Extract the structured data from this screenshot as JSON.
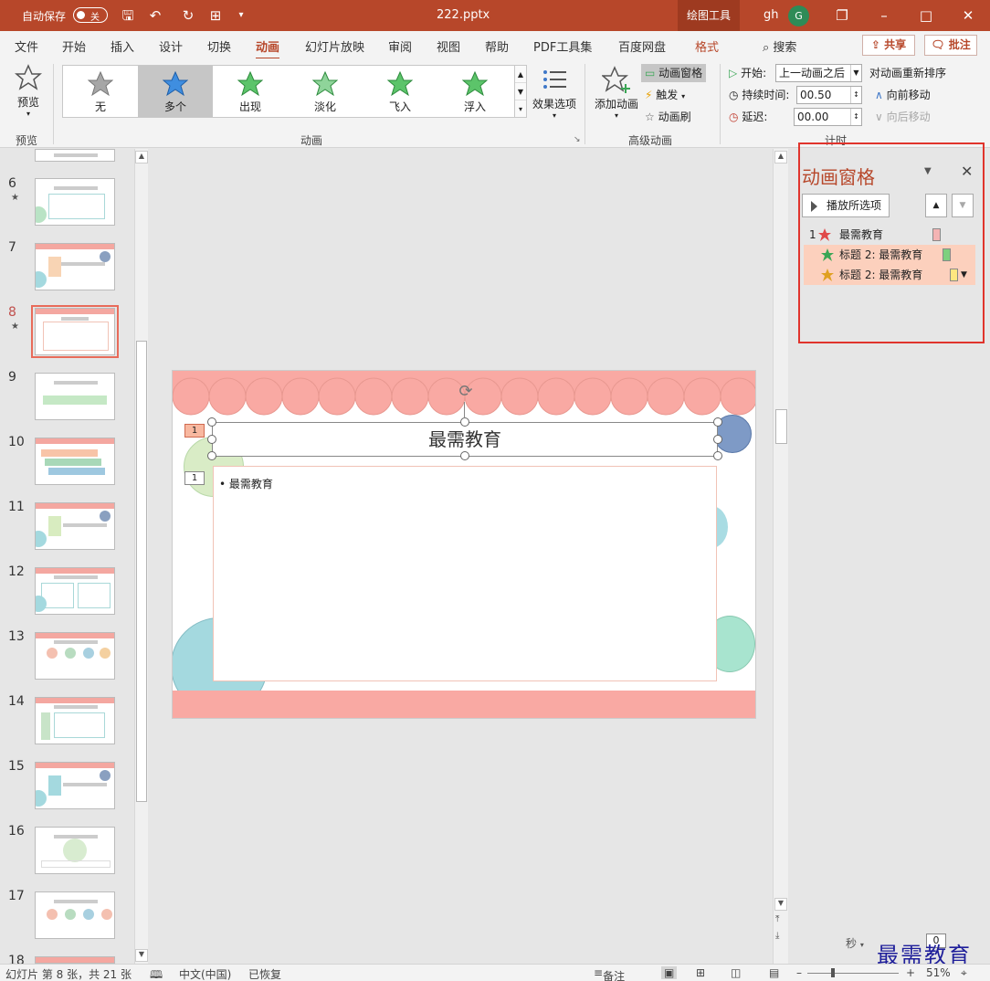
{
  "titlebar": {
    "autosave_label": "自动保存",
    "autosave_state": "关",
    "filename": "222.pptx",
    "context_tab": "绘图工具",
    "user_name": "gh",
    "user_initial": "G"
  },
  "tabs": [
    "文件",
    "开始",
    "插入",
    "设计",
    "切换",
    "动画",
    "幻灯片放映",
    "审阅",
    "视图",
    "帮助",
    "PDF工具集",
    "百度网盘",
    "格式"
  ],
  "active_tab": "动画",
  "search_label": "搜索",
  "share_label": "共享",
  "comment_label": "批注",
  "ribbon": {
    "preview_label": "预览",
    "preview_group": "预览",
    "gallery": [
      {
        "label": "无",
        "color": "#a6a6a6"
      },
      {
        "label": "多个",
        "color": "#3f8ee0"
      },
      {
        "label": "出现",
        "color": "#5cc46a"
      },
      {
        "label": "淡化",
        "color": "#8fd49a"
      },
      {
        "label": "飞入",
        "color": "#5cc46a"
      },
      {
        "label": "浮入",
        "color": "#5cc46a"
      }
    ],
    "effect_options": "效果选项",
    "animation_group": "动画",
    "add_animation": "添加动画",
    "animation_pane": "动画窗格",
    "trigger": "触发",
    "animation_painter": "动画刷",
    "advanced_group": "高级动画",
    "start_label": "开始:",
    "start_value": "上一动画之后",
    "duration_label": "持续时间:",
    "duration_value": "00.50",
    "delay_label": "延迟:",
    "delay_value": "00.00",
    "reorder_label": "对动画重新排序",
    "move_earlier": "向前移动",
    "move_later": "向后移动",
    "timing_group": "计时"
  },
  "thumbnails": [
    {
      "num": "6",
      "star": "★"
    },
    {
      "num": "7",
      "star": ""
    },
    {
      "num": "8",
      "star": "★"
    },
    {
      "num": "9",
      "star": ""
    },
    {
      "num": "10",
      "star": ""
    },
    {
      "num": "11",
      "star": ""
    },
    {
      "num": "12",
      "star": ""
    },
    {
      "num": "13",
      "star": ""
    },
    {
      "num": "14",
      "star": ""
    },
    {
      "num": "15",
      "star": ""
    },
    {
      "num": "16",
      "star": ""
    },
    {
      "num": "17",
      "star": ""
    },
    {
      "num": "18",
      "star": ""
    }
  ],
  "current_slide": "8",
  "slide": {
    "title": "最需教育",
    "bullet": "最需教育",
    "tag_title": "1",
    "tag_body": "1"
  },
  "anim_pane": {
    "title": "动画窗格",
    "play_label": "播放所选项",
    "items": [
      {
        "num": "1",
        "label": "最需教育",
        "star_color": "#e04848",
        "bar_color": "#f4b4b4",
        "selected": false
      },
      {
        "num": "",
        "label": "标题 2: 最需教育",
        "star_color": "#3aa655",
        "bar_color": "#7ed07e",
        "selected": true
      },
      {
        "num": "",
        "label": "标题 2: 最需教育",
        "star_color": "#e0a020",
        "bar_color": "#ffe680",
        "selected": true
      }
    ],
    "seconds_label": "秒",
    "zero_label": "0"
  },
  "status": {
    "slide_info": "幻灯片 第 8 张，共 21 张",
    "language": "中文(中国)",
    "recovered": "已恢复",
    "notes": "备注",
    "zoom": "51%"
  },
  "watermark": "最需教育"
}
